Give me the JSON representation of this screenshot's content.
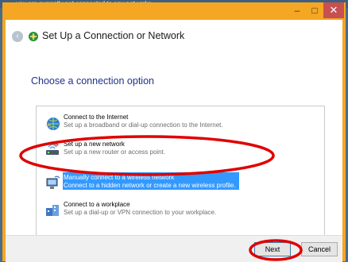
{
  "background": {
    "behind_text": "you are currently not connected to any networks"
  },
  "window": {
    "minimize_glyph": "–",
    "maximize_glyph": "□",
    "close_glyph": "✕",
    "back_glyph": "‹",
    "title": "Set Up a Connection or Network",
    "accent_color": "#f5a623"
  },
  "page": {
    "heading": "Choose a connection option",
    "options": [
      {
        "title": "Connect to the Internet",
        "desc": "Set up a broadband or dial-up connection to the Internet.",
        "icon": "internet-globe-icon",
        "selected": false
      },
      {
        "title": "Set up a new network",
        "desc": "Set up a new router or access point.",
        "icon": "router-icon",
        "selected": false
      },
      {
        "title": "Manually connect to a wireless network",
        "desc": "Connect to a hidden network or create a new wireless profile.",
        "icon": "wireless-computer-icon",
        "selected": true
      },
      {
        "title": "Connect to a workplace",
        "desc": "Set up a dial-up or VPN connection to your workplace.",
        "icon": "workplace-icon",
        "selected": false
      }
    ]
  },
  "footer": {
    "next_label": "Next",
    "cancel_label": "Cancel"
  },
  "colors": {
    "selection": "#3399ff",
    "annotation": "#e00000",
    "heading": "#1e3287"
  }
}
